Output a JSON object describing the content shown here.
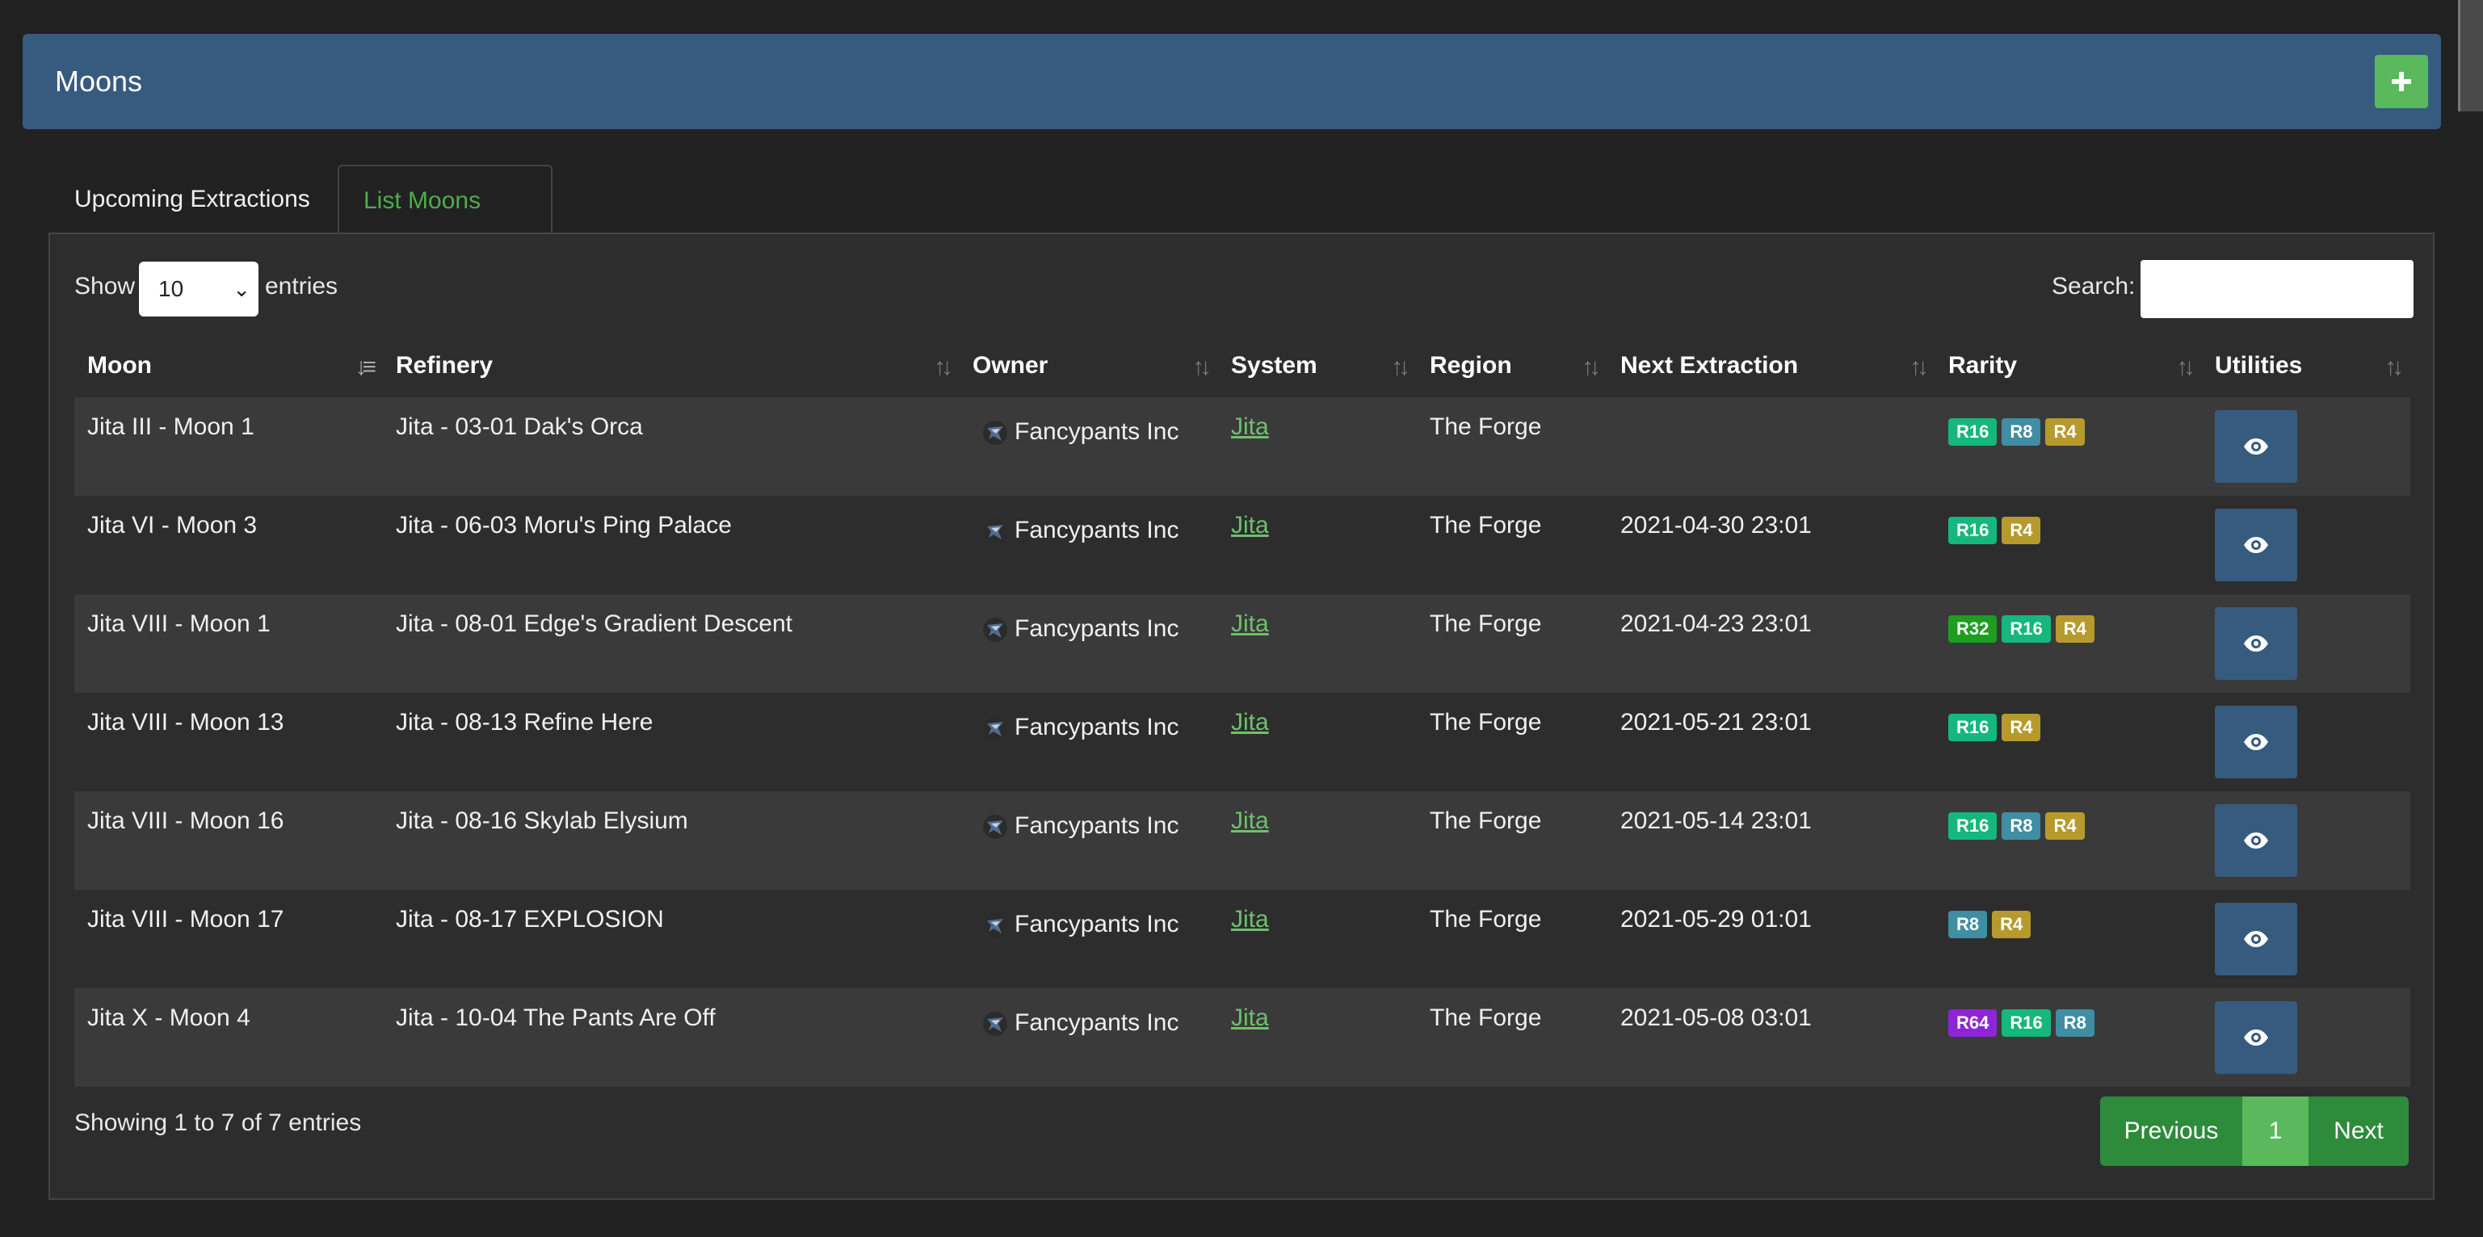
{
  "header": {
    "title": "Moons",
    "add_label": "+"
  },
  "tabs": [
    {
      "label": "Upcoming Extractions",
      "active": false
    },
    {
      "label": "List Moons",
      "active": true
    }
  ],
  "controls": {
    "show_label": "Show",
    "length_value": "10",
    "entries_label": "entries",
    "search_label": "Search:",
    "search_value": ""
  },
  "table": {
    "columns": [
      "Moon",
      "Refinery",
      "Owner",
      "System",
      "Region",
      "Next Extraction",
      "Rarity",
      "Utilities"
    ],
    "rows": [
      {
        "moon": "Jita III - Moon 1",
        "refinery": "Jita - 03-01 Dak's Orca",
        "owner": "Fancypants Inc",
        "system": "Jita",
        "region": "The Forge",
        "next": "",
        "rarity": [
          "R16",
          "R8",
          "R4"
        ]
      },
      {
        "moon": "Jita VI - Moon 3",
        "refinery": "Jita - 06-03 Moru's Ping Palace",
        "owner": "Fancypants Inc",
        "system": "Jita",
        "region": "The Forge",
        "next": "2021-04-30 23:01",
        "rarity": [
          "R16",
          "R4"
        ]
      },
      {
        "moon": "Jita VIII - Moon 1",
        "refinery": "Jita - 08-01 Edge's Gradient Descent",
        "owner": "Fancypants Inc",
        "system": "Jita",
        "region": "The Forge",
        "next": "2021-04-23 23:01",
        "rarity": [
          "R32",
          "R16",
          "R4"
        ]
      },
      {
        "moon": "Jita VIII - Moon 13",
        "refinery": "Jita - 08-13 Refine Here",
        "owner": "Fancypants Inc",
        "system": "Jita",
        "region": "The Forge",
        "next": "2021-05-21 23:01",
        "rarity": [
          "R16",
          "R4"
        ]
      },
      {
        "moon": "Jita VIII - Moon 16",
        "refinery": "Jita - 08-16 Skylab Elysium",
        "owner": "Fancypants Inc",
        "system": "Jita",
        "region": "The Forge",
        "next": "2021-05-14 23:01",
        "rarity": [
          "R16",
          "R8",
          "R4"
        ]
      },
      {
        "moon": "Jita VIII - Moon 17",
        "refinery": "Jita - 08-17 EXPLOSION",
        "owner": "Fancypants Inc",
        "system": "Jita",
        "region": "The Forge",
        "next": "2021-05-29 01:01",
        "rarity": [
          "R8",
          "R4"
        ]
      },
      {
        "moon": "Jita X - Moon 4",
        "refinery": "Jita - 10-04 The Pants Are Off",
        "owner": "Fancypants Inc",
        "system": "Jita",
        "region": "The Forge",
        "next": "2021-05-08 03:01",
        "rarity": [
          "R64",
          "R16",
          "R8"
        ]
      }
    ]
  },
  "rarity_colors": {
    "R64": "#8e24d6",
    "R32": "#1e9e1e",
    "R16": "#15b77e",
    "R8": "#3f8ea3",
    "R4": "#b69a2e"
  },
  "icons": {
    "add": "plus-icon",
    "view": "eye-icon",
    "owner": "corporation-logo-icon",
    "sort": "sort-icon"
  },
  "footer": {
    "info": "Showing 1 to 7 of 7 entries",
    "previous": "Previous",
    "page": "1",
    "next": "Next"
  }
}
